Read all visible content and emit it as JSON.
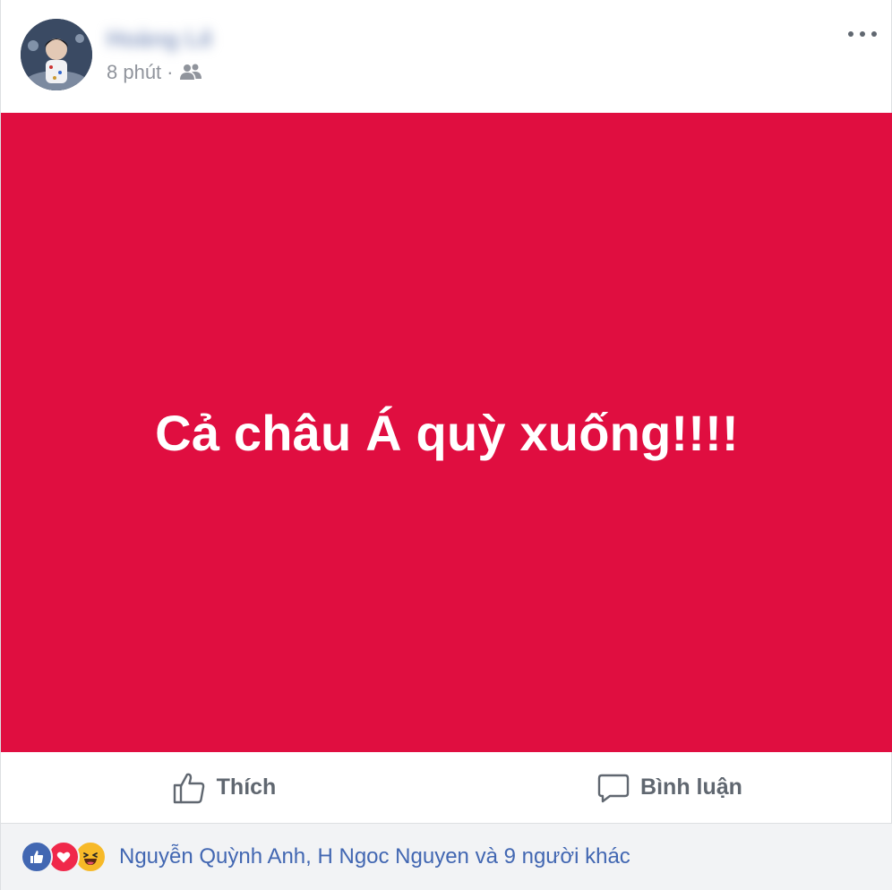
{
  "post": {
    "author": "Hoàng Lê",
    "time": "8 phút",
    "separator": "·",
    "audience_icon": "friends-icon",
    "more_icon": "more-options-icon",
    "status_text": "Cả châu Á quỳ xuống!!!!",
    "status_background": "#e00e40"
  },
  "actions": {
    "like_label": "Thích",
    "comment_label": "Bình luận"
  },
  "reactions": {
    "icons": [
      "like-reaction-icon",
      "love-reaction-icon",
      "haha-reaction-icon"
    ],
    "names_text": "Nguyễn Quỳnh Anh, H Ngoc Nguyen và 9 người khác"
  },
  "colors": {
    "link_blue": "#4267b2",
    "action_gray": "#606770",
    "meta_gray": "#90949c",
    "reaction_bar_bg": "#f2f3f5"
  }
}
